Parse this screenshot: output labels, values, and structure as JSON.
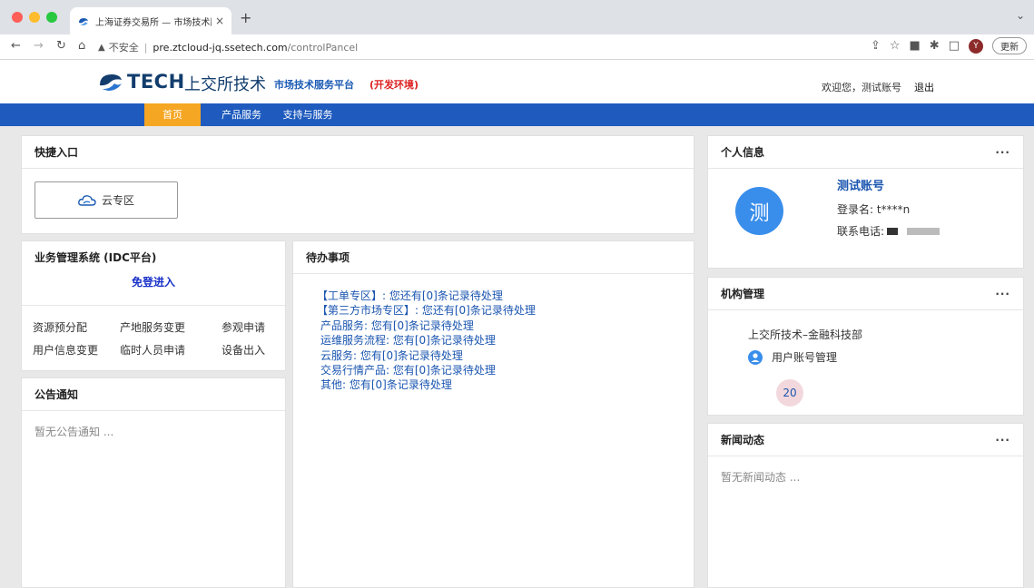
{
  "browser": {
    "tab_title": "上海证券交易所 — 市场技术服",
    "tab_close": "×",
    "new_tab": "+",
    "tab_menu": "⌄",
    "insecure_label": "不安全",
    "url_host": "pre.ztcloud-jq.ssetech.com",
    "url_path": "/controlPancel",
    "profile_initial": "Y",
    "update_label": "更新"
  },
  "header": {
    "logo_tech": "TECH",
    "logo_cn": "上交所技术",
    "platform_name": "市场技术服务平台",
    "env_label": "(开发环境)",
    "welcome": "欢迎您，测试账号",
    "logout": "退出"
  },
  "nav": {
    "items": [
      "首页",
      "产品服务",
      "支持与服务"
    ],
    "active": "首页",
    "active_color": "#f5a623",
    "bar_color": "#1f5bbe"
  },
  "quick_entry": {
    "title": "快捷入口",
    "cloud_button": "云专区"
  },
  "idc": {
    "title": "业务管理系统 (IDC平台)",
    "free_login": "免登进入",
    "links": [
      "资源预分配",
      "产地服务变更",
      "参观申请",
      "用户信息变更",
      "临时人员申请",
      "设备出入"
    ]
  },
  "notice": {
    "title": "公告通知",
    "empty": "暂无公告通知 ..."
  },
  "todo": {
    "title": "待办事项",
    "items": [
      "【工单专区】: 您还有[0]条记录待处理",
      "【第三方市场专区】: 您还有[0]条记录待处理",
      "产品服务: 您有[0]条记录待处理",
      "运维服务流程: 您有[0]条记录待处理",
      "云服务: 您有[0]条记录待处理",
      "交易行情产品: 您有[0]条记录待处理",
      "其他: 您有[0]条记录待处理"
    ]
  },
  "profile": {
    "title": "个人信息",
    "more": "···",
    "avatar_char": "测",
    "name": "测试账号",
    "login_label": "登录名: t****n",
    "phone_label": "联系电话:"
  },
  "org": {
    "title": "机构管理",
    "more": "···",
    "org_name": "上交所技术–金融科技部",
    "account_mgmt": "用户账号管理",
    "count": "20"
  },
  "news": {
    "title": "新闻动态",
    "more": "···",
    "empty": "暂无新闻动态 ..."
  }
}
